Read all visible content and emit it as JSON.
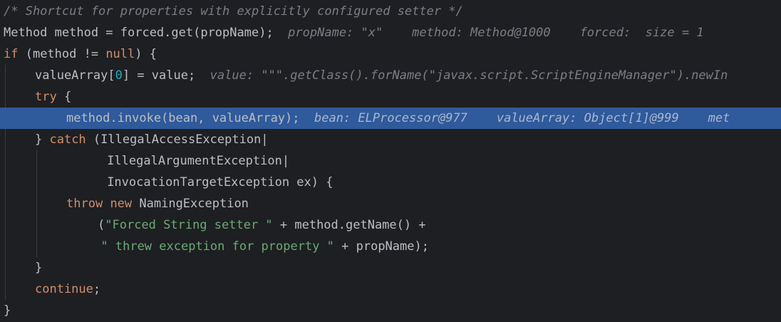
{
  "lines": [
    {
      "indent": 0,
      "tokens": [
        {
          "t": "cmt",
          "v": "/* Shortcut for properties with explicitly configured setter */"
        }
      ]
    },
    {
      "indent": 0,
      "tokens": [
        {
          "t": "plain",
          "v": "Method method = forced.get(propName);"
        },
        {
          "t": "hint",
          "v": "  propName: \"x\"    method: Method@1000    forced:  size = 1"
        }
      ]
    },
    {
      "indent": 0,
      "tokens": [
        {
          "t": "kw",
          "v": "if"
        },
        {
          "t": "plain",
          "v": " (method != "
        },
        {
          "t": "kw",
          "v": "null"
        },
        {
          "t": "plain",
          "v": ") {"
        }
      ]
    },
    {
      "indent": 1,
      "tokens": [
        {
          "t": "plain",
          "v": "valueArray["
        },
        {
          "t": "num",
          "v": "0"
        },
        {
          "t": "plain",
          "v": "] = value;"
        },
        {
          "t": "hint",
          "v": "  value: \"\"\".getClass().forName(\"javax.script.ScriptEngineManager\").newIn"
        }
      ]
    },
    {
      "indent": 1,
      "tokens": [
        {
          "t": "kw",
          "v": "try"
        },
        {
          "t": "plain",
          "v": " {"
        }
      ]
    },
    {
      "indent": 2,
      "current": true,
      "tokens": [
        {
          "t": "plain",
          "v": "method.invoke(bean, valueArray);"
        },
        {
          "t": "hint",
          "v": "  bean: ELProcessor@977    valueArray: Object[1]@999    met"
        }
      ]
    },
    {
      "indent": 1,
      "tokens": [
        {
          "t": "plain",
          "v": "} "
        },
        {
          "t": "kw",
          "v": "catch"
        },
        {
          "t": "plain",
          "v": " (IllegalAccessException|"
        }
      ]
    },
    {
      "indent": 3.3,
      "tokens": [
        {
          "t": "plain",
          "v": "IllegalArgumentException|"
        }
      ]
    },
    {
      "indent": 3.3,
      "tokens": [
        {
          "t": "plain",
          "v": "InvocationTargetException ex) {"
        }
      ]
    },
    {
      "indent": 2,
      "tokens": [
        {
          "t": "kw",
          "v": "throw"
        },
        {
          "t": "plain",
          "v": " "
        },
        {
          "t": "kw",
          "v": "new"
        },
        {
          "t": "plain",
          "v": " NamingException"
        }
      ]
    },
    {
      "indent": 3,
      "tokens": [
        {
          "t": "plain",
          "v": "("
        },
        {
          "t": "str",
          "v": "\"Forced String setter \""
        },
        {
          "t": "plain",
          "v": " + method.getName() +"
        }
      ]
    },
    {
      "indent": 3.1,
      "tokens": [
        {
          "t": "str",
          "v": "\" threw exception for property \""
        },
        {
          "t": "plain",
          "v": " + propName);"
        }
      ]
    },
    {
      "indent": 1,
      "tokens": [
        {
          "t": "plain",
          "v": "}"
        }
      ]
    },
    {
      "indent": 1,
      "tokens": [
        {
          "t": "kw",
          "v": "continue"
        },
        {
          "t": "plain",
          "v": ";"
        }
      ]
    },
    {
      "indent": 0,
      "tokens": [
        {
          "t": "plain",
          "v": "}"
        }
      ]
    }
  ],
  "theme": {
    "background": "#1e1f22",
    "current_line": "#2f5a9b",
    "keyword": "#cf8e6d",
    "string": "#6aab73",
    "number": "#2aacb8",
    "comment": "#7a7e85"
  }
}
